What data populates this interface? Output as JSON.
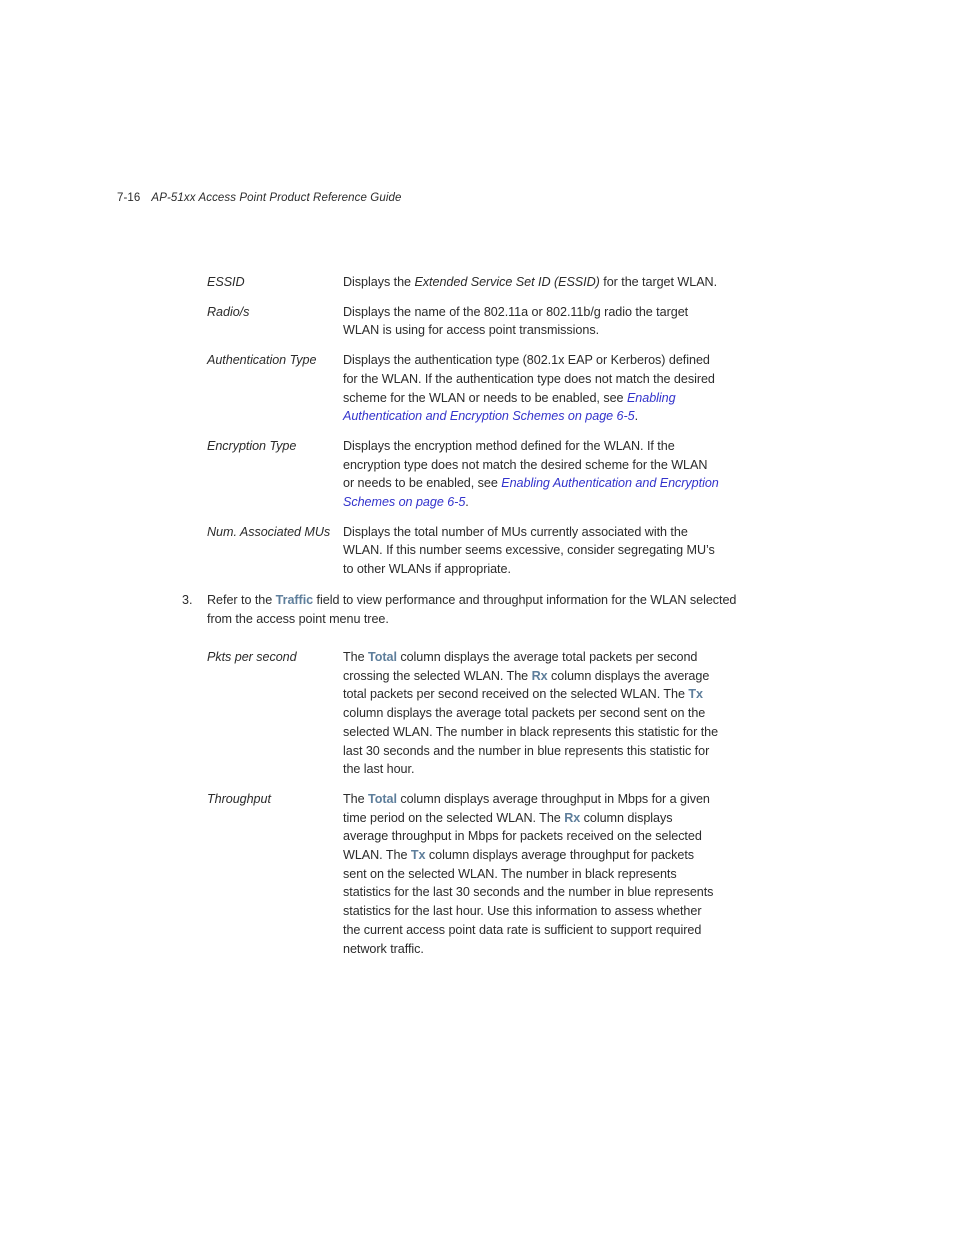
{
  "header": {
    "folio": "7-16",
    "book_title": "AP-51xx Access Point Product Reference Guide"
  },
  "colors": {
    "body_text": "#2b2b2b",
    "cross_reference_link": "#3333cc",
    "ui_term_accent": "#5e7e9b",
    "page_background": "#ffffff"
  },
  "definition_list_1": [
    {
      "term": "ESSID",
      "description_parts": [
        {
          "type": "text",
          "value": "Displays the "
        },
        {
          "type": "italic",
          "value": "Extended Service Set ID (ESSID)"
        },
        {
          "type": "text",
          "value": " for the target WLAN."
        }
      ],
      "description_plain": "Displays the Extended Service Set ID (ESSID) for the target WLAN."
    },
    {
      "term": "Radio/s",
      "description_parts": [
        {
          "type": "text",
          "value": "Displays the name of the 802.11a or 802.11b/g radio the target WLAN is using for access point transmissions."
        }
      ],
      "description_plain": "Displays the name of the 802.11a or 802.11b/g radio the target WLAN is using for access point transmissions."
    },
    {
      "term": "Authentication Type",
      "description_parts": [
        {
          "type": "text",
          "value": "Displays the authentication type (802.1x EAP or Kerberos) defined for the WLAN. If the authentication type does not match the desired scheme for the WLAN or needs to be enabled, see "
        },
        {
          "type": "link",
          "value": "Enabling Authentication and Encryption Schemes on page 6-5"
        },
        {
          "type": "text",
          "value": "."
        }
      ],
      "description_plain": "Displays the authentication type (802.1x EAP or Kerberos) defined for the WLAN. If the authentication type does not match the desired scheme for the WLAN or needs to be enabled, see Enabling Authentication and Encryption Schemes on page 6-5."
    },
    {
      "term": "Encryption Type",
      "description_parts": [
        {
          "type": "text",
          "value": "Displays the encryption method defined for the WLAN. If the encryption type does not match the desired scheme for the WLAN or needs to be enabled, see "
        },
        {
          "type": "link",
          "value": "Enabling Authentication and Encryption Schemes on page 6-5"
        },
        {
          "type": "text",
          "value": "."
        }
      ],
      "description_plain": "Displays the encryption method defined for the WLAN. If the encryption type does not match the desired scheme for the WLAN or needs to be enabled, see Enabling Authentication and Encryption Schemes on page 6-5."
    },
    {
      "term": "Num. Associated MUs",
      "description_parts": [
        {
          "type": "text",
          "value": "Displays the total number of MUs currently associated with the WLAN. If this number seems excessive, consider segregating MU’s to other WLANs if appropriate."
        }
      ],
      "description_plain": "Displays the total number of MUs currently associated with the WLAN. If this number seems excessive, consider segregating MU’s to other WLANs if appropriate."
    }
  ],
  "step": {
    "number": "3.",
    "parts": [
      {
        "type": "text",
        "value": "Refer to the "
      },
      {
        "type": "ui",
        "value": "Traffic"
      },
      {
        "type": "text",
        "value": " field to view performance and throughput information for the WLAN selected from the access point menu tree."
      }
    ],
    "plain": "Refer to the Traffic field to view performance and throughput information for the WLAN selected from the access point menu tree."
  },
  "definition_list_2": [
    {
      "term": "Pkts per second",
      "description_parts": [
        {
          "type": "text",
          "value": "The "
        },
        {
          "type": "ui",
          "value": "Total"
        },
        {
          "type": "text",
          "value": " column displays the average total packets per second crossing the selected WLAN. The "
        },
        {
          "type": "ui",
          "value": "Rx"
        },
        {
          "type": "text",
          "value": " column displays the average total packets per second received on the selected WLAN. The "
        },
        {
          "type": "ui",
          "value": "Tx"
        },
        {
          "type": "text",
          "value": " column displays the average total packets per second sent on the selected WLAN. The number in black represents this statistic for the last 30 seconds and the number in blue represents this statistic for the last hour."
        }
      ],
      "description_plain": "The Total column displays the average total packets per second crossing the selected WLAN. The Rx column displays the average total packets per second received on the selected WLAN. The Tx column displays the average total packets per second sent on the selected WLAN. The number in black represents this statistic for the last 30 seconds and the number in blue represents this statistic for the last hour."
    },
    {
      "term": "Throughput",
      "description_parts": [
        {
          "type": "text",
          "value": "The "
        },
        {
          "type": "ui",
          "value": "Total"
        },
        {
          "type": "text",
          "value": " column displays average throughput in Mbps for a given time period on the selected WLAN. The "
        },
        {
          "type": "ui",
          "value": "Rx"
        },
        {
          "type": "text",
          "value": " column displays average throughput in Mbps for packets received on the selected WLAN. The "
        },
        {
          "type": "ui",
          "value": "Tx"
        },
        {
          "type": "text",
          "value": " column displays average throughput for packets sent on the selected WLAN. The number in black represents statistics for the last 30 seconds and the number in blue represents statistics for the last hour. Use this information to assess whether the current access point data rate is sufficient to support required network traffic."
        }
      ],
      "description_plain": "The Total column displays average throughput in Mbps for a given time period on the selected WLAN. The Rx column displays average throughput in Mbps for packets received on the selected WLAN. The Tx column displays average throughput for packets sent on the selected WLAN. The number in black represents statistics for the last 30 seconds and the number in blue represents statistics for the last hour. Use this information to assess whether the current access point data rate is sufficient to support required network traffic."
    }
  ]
}
